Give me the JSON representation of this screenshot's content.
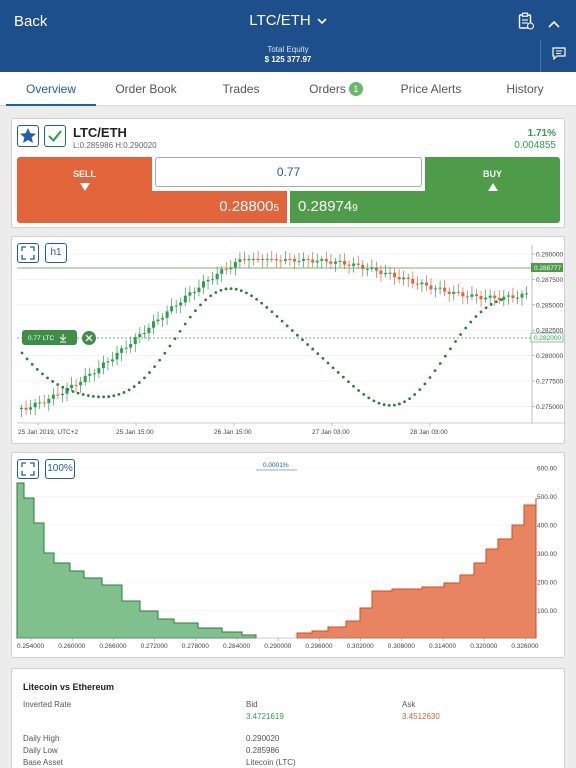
{
  "header": {
    "back_label": "Back",
    "pair": "LTC/ETH",
    "equity_label": "Total Equity",
    "equity_value": "$ 125 377.97"
  },
  "tabs": [
    {
      "label": "Overview",
      "active": true
    },
    {
      "label": "Order Book"
    },
    {
      "label": "Trades"
    },
    {
      "label": "Orders",
      "badge": "1"
    },
    {
      "label": "Price Alerts"
    },
    {
      "label": "History"
    }
  ],
  "ticket": {
    "symbol": "LTC/ETH",
    "low_high": "L:0.285986 H:0.290020",
    "change_pct": "1.71%",
    "change_abs": "0.004855",
    "sell_label": "SELL",
    "buy_label": "BUY",
    "quantity": "0.77",
    "sell_price_main": "0.28800",
    "sell_price_small": "5",
    "buy_price_main": "0.28974",
    "buy_price_small": "9",
    "colors": {
      "sell": "#e2643a",
      "buy": "#4e9c4a",
      "accent": "#1d5fa8"
    }
  },
  "price_chart": {
    "timeframe": "h1",
    "order_tag": "0.77 LTC",
    "y_ticks": [
      "0.290000",
      "0.287500",
      "0.285000",
      "0.282500",
      "0.280000",
      "0.277500",
      "0.275000"
    ],
    "current_price_tag": "0.288777",
    "order_price_tag": "0.282000",
    "x_ticks": [
      "25 Jan 2019, UTC+2",
      "25 Jan 15:00",
      "26 Jan 15:00",
      "27 Jan 03:00",
      "28 Jan 03:00"
    ]
  },
  "depth_chart": {
    "zoom": "100%",
    "spread": "0.0001%",
    "y_ticks": [
      "600.00",
      "500.00",
      "400.00",
      "300.00",
      "200.00",
      "100.00"
    ],
    "x_ticks": [
      "0.254000",
      "0.260000",
      "0.266000",
      "0.272000",
      "0.278000",
      "0.284000",
      "0.290000",
      "0.296000",
      "0.302000",
      "0.308000",
      "0.314000",
      "0.320000",
      "0.326000"
    ]
  },
  "info": {
    "title": "Litecoin vs Ethereum",
    "inverted_rate_label": "Inverted Rate",
    "bid_label": "Bid",
    "bid_value": "3.4721619",
    "ask_label": "Ask",
    "ask_value": "3.4512630",
    "daily_high_label": "Daily High",
    "daily_high_value": "0.290020",
    "daily_low_label": "Daily Low",
    "daily_low_value": "0.285986",
    "base_asset_label": "Base Asset",
    "base_asset_value": "Litecoin (LTC)"
  }
}
